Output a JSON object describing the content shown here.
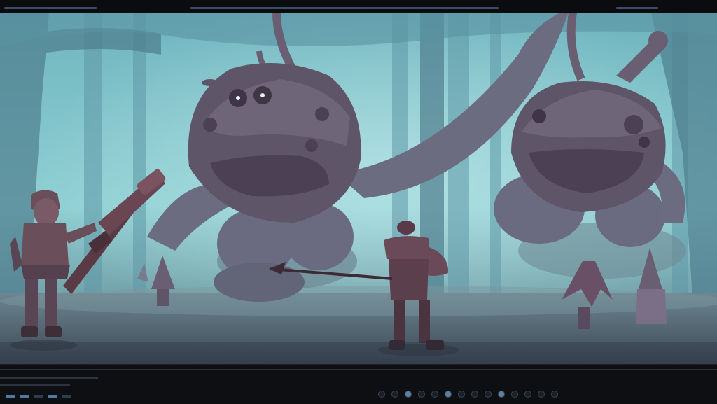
{
  "scene": {
    "name": "forest-battle-scene",
    "colors": {
      "fog": "#8fd0d4",
      "shadow": "#4a3d4d",
      "accent": "#5d7fa0"
    }
  },
  "ui": {
    "top_segments": 3,
    "dock_items": 14,
    "tray_items": 5
  }
}
